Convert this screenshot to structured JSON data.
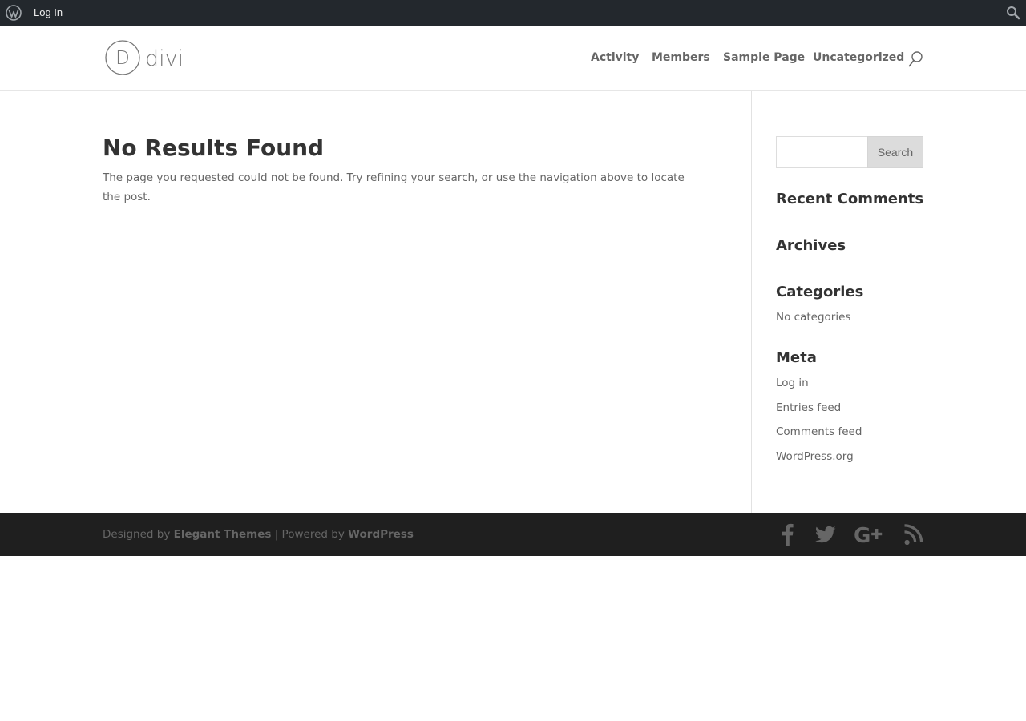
{
  "adminbar": {
    "login_label": "Log In",
    "icons": [
      "wordpress-icon",
      "search-icon"
    ]
  },
  "header": {
    "logo_text": "divi",
    "logo_letter": "D",
    "nav": [
      {
        "label": "Activity"
      },
      {
        "label": "Members"
      },
      {
        "label": "Sample Page"
      },
      {
        "label": "Uncategorized"
      }
    ]
  },
  "main": {
    "title": "No Results Found",
    "message": "The page you requested could not be found. Try refining your search, or use the navigation above to locate the post."
  },
  "sidebar": {
    "search": {
      "placeholder": "",
      "value": "",
      "button_label": "Search"
    },
    "recent_comments_title": "Recent Comments",
    "archives_title": "Archives",
    "categories_title": "Categories",
    "categories_empty": "No categories",
    "meta_title": "Meta",
    "meta_links": [
      "Log in",
      "Entries feed",
      "Comments feed",
      "WordPress.org"
    ]
  },
  "footer": {
    "designed_by": "Designed by",
    "designer": "Elegant Themes",
    "separator": "| Powered by",
    "platform": "WordPress",
    "social_icons": [
      "facebook-icon",
      "twitter-icon",
      "google-plus-icon",
      "rss-icon"
    ]
  },
  "colors": {
    "adminbar_bg": "#23282d",
    "footer_bg": "#1f1f1f",
    "text": "#666666",
    "heading": "#333333",
    "social_icon": "#666666"
  }
}
